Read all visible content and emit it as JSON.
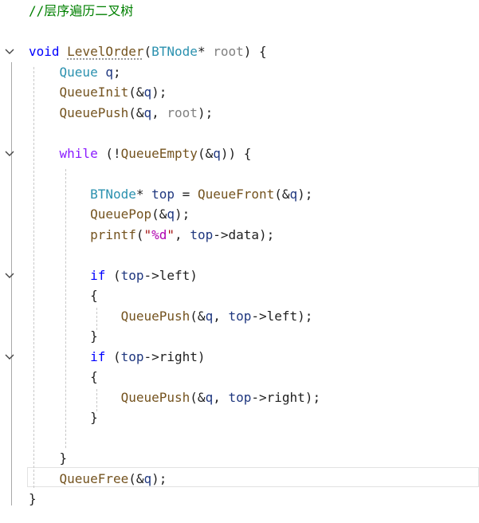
{
  "editor": {
    "lines": [
      [
        {
          "t": "//层序遍历二叉树",
          "c": "cm"
        }
      ],
      [],
      [
        {
          "t": "void",
          "c": "kw"
        },
        {
          "t": " "
        },
        {
          "t": "LevelOrder",
          "c": "fn",
          "u": true
        },
        {
          "t": "("
        },
        {
          "t": "BTNode",
          "c": "ty"
        },
        {
          "t": "* "
        },
        {
          "t": "root",
          "c": "pm"
        },
        {
          "t": ") {"
        }
      ],
      [
        {
          "t": "    "
        },
        {
          "t": "Queue",
          "c": "ty"
        },
        {
          "t": " "
        },
        {
          "t": "q",
          "c": "vr"
        },
        {
          "t": ";"
        }
      ],
      [
        {
          "t": "    "
        },
        {
          "t": "QueueInit",
          "c": "fn"
        },
        {
          "t": "(&"
        },
        {
          "t": "q",
          "c": "vr"
        },
        {
          "t": ");"
        }
      ],
      [
        {
          "t": "    "
        },
        {
          "t": "QueuePush",
          "c": "fn"
        },
        {
          "t": "(&"
        },
        {
          "t": "q",
          "c": "vr"
        },
        {
          "t": ", "
        },
        {
          "t": "root",
          "c": "pm"
        },
        {
          "t": ");"
        }
      ],
      [],
      [
        {
          "t": "    "
        },
        {
          "t": "while",
          "c": "mc"
        },
        {
          "t": " (!"
        },
        {
          "t": "QueueEmpty",
          "c": "fn"
        },
        {
          "t": "(&"
        },
        {
          "t": "q",
          "c": "vr"
        },
        {
          "t": ")) {"
        }
      ],
      [],
      [
        {
          "t": "        "
        },
        {
          "t": "BTNode",
          "c": "ty"
        },
        {
          "t": "* "
        },
        {
          "t": "top",
          "c": "vr"
        },
        {
          "t": " = "
        },
        {
          "t": "QueueFront",
          "c": "fn"
        },
        {
          "t": "(&"
        },
        {
          "t": "q",
          "c": "vr"
        },
        {
          "t": ");"
        }
      ],
      [
        {
          "t": "        "
        },
        {
          "t": "QueuePop",
          "c": "fn"
        },
        {
          "t": "(&"
        },
        {
          "t": "q",
          "c": "vr"
        },
        {
          "t": ");"
        }
      ],
      [
        {
          "t": "        "
        },
        {
          "t": "printf",
          "c": "fn"
        },
        {
          "t": "("
        },
        {
          "t": "\"",
          "c": "st"
        },
        {
          "t": "%d",
          "c": "fm"
        },
        {
          "t": "\"",
          "c": "st"
        },
        {
          "t": ", "
        },
        {
          "t": "top",
          "c": "vr"
        },
        {
          "t": "->data);"
        }
      ],
      [],
      [
        {
          "t": "        "
        },
        {
          "t": "if",
          "c": "kw"
        },
        {
          "t": " ("
        },
        {
          "t": "top",
          "c": "vr"
        },
        {
          "t": "->left)"
        }
      ],
      [
        {
          "t": "        {"
        }
      ],
      [
        {
          "t": "            "
        },
        {
          "t": "QueuePush",
          "c": "fn"
        },
        {
          "t": "(&"
        },
        {
          "t": "q",
          "c": "vr"
        },
        {
          "t": ", "
        },
        {
          "t": "top",
          "c": "vr"
        },
        {
          "t": "->left);"
        }
      ],
      [
        {
          "t": "        }"
        }
      ],
      [
        {
          "t": "        "
        },
        {
          "t": "if",
          "c": "kw"
        },
        {
          "t": " ("
        },
        {
          "t": "top",
          "c": "vr"
        },
        {
          "t": "->right)"
        }
      ],
      [
        {
          "t": "        {"
        }
      ],
      [
        {
          "t": "            "
        },
        {
          "t": "QueuePush",
          "c": "fn"
        },
        {
          "t": "(&"
        },
        {
          "t": "q",
          "c": "vr"
        },
        {
          "t": ", "
        },
        {
          "t": "top",
          "c": "vr"
        },
        {
          "t": "->right);"
        }
      ],
      [
        {
          "t": "        }"
        }
      ],
      [],
      [
        {
          "t": "    }"
        }
      ],
      [
        {
          "t": "    "
        },
        {
          "t": "QueueFree",
          "c": "fn"
        },
        {
          "t": "(&"
        },
        {
          "t": "q",
          "c": "vr"
        },
        {
          "t": ");"
        }
      ],
      [
        {
          "t": "}"
        }
      ]
    ],
    "fold_marks": [
      2,
      7,
      13,
      17
    ]
  }
}
